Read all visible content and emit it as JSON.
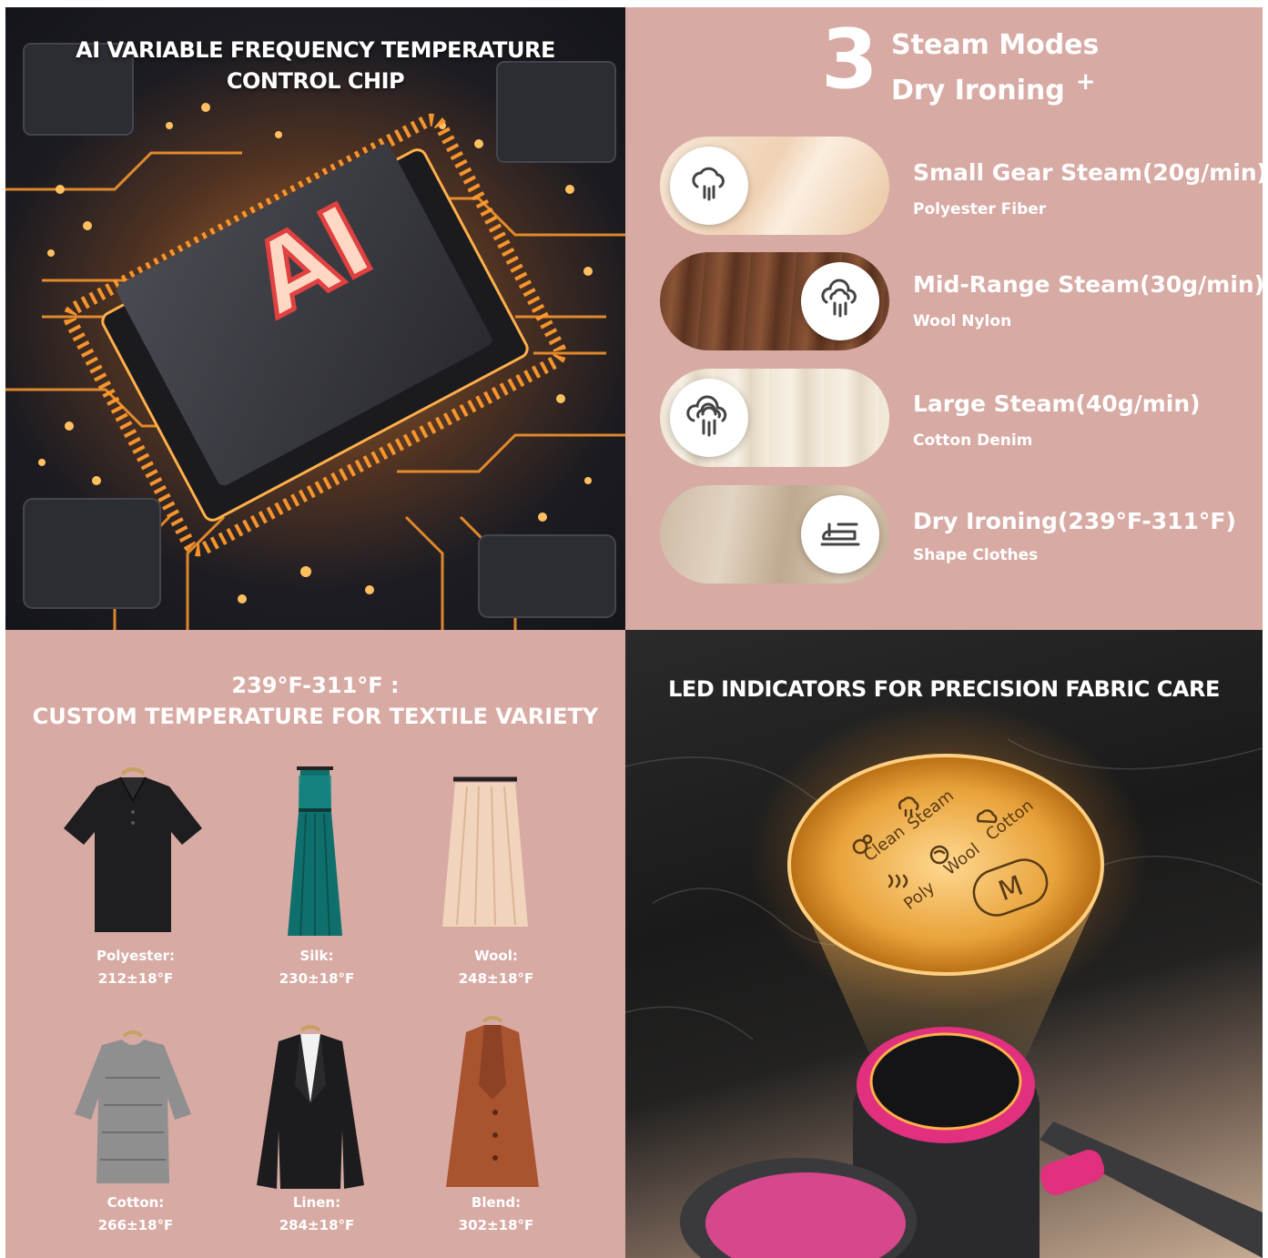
{
  "chip_panel": {
    "title_line1": "AI VARIABLE FREQUENCY TEMPERATURE",
    "title_line2": "CONTROL CHIP",
    "chip_label": "AI"
  },
  "modes_panel": {
    "count": "3",
    "heading_line1": "Steam Modes",
    "heading_line2": "Dry Ironing",
    "plus": "+",
    "modes": [
      {
        "title": "Small Gear Steam(20g/min)",
        "subtitle": "Polyester Fiber",
        "icon": "small-steam-icon"
      },
      {
        "title": "Mid-Range Steam(30g/min)",
        "subtitle": "Wool Nylon",
        "icon": "mid-steam-icon"
      },
      {
        "title": "Large Steam(40g/min)",
        "subtitle": "Cotton Denim",
        "icon": "large-steam-icon"
      },
      {
        "title": "Dry Ironing(239°F-311°F)",
        "subtitle": "Shape Clothes",
        "icon": "iron-icon"
      }
    ]
  },
  "fabric_panel": {
    "title_line1": "239°F-311°F :",
    "title_line2": "CUSTOM TEMPERATURE FOR TEXTILE VARIETY",
    "fabrics": [
      {
        "name": "Polyester:",
        "temp": "212±18°F"
      },
      {
        "name": "Silk:",
        "temp": "230±18°F"
      },
      {
        "name": "Wool:",
        "temp": "248±18°F"
      },
      {
        "name": "Cotton:",
        "temp": "266±18°F"
      },
      {
        "name": "Linen:",
        "temp": "284±18°F"
      },
      {
        "name": "Blend:",
        "temp": "302±18°F"
      }
    ]
  },
  "led_panel": {
    "title": "LED INDICATORS FOR PRECISION FABRIC CARE",
    "indicators": {
      "clean": "Clean",
      "steam": "Steam",
      "cotton": "Cotton",
      "wool": "Wool",
      "poly": "Poly",
      "mode": "M"
    }
  },
  "colors": {
    "panel_pink": "#d8aaa4",
    "glow_orange": "#ff9a2e",
    "accent_magenta": "#e0307e"
  }
}
